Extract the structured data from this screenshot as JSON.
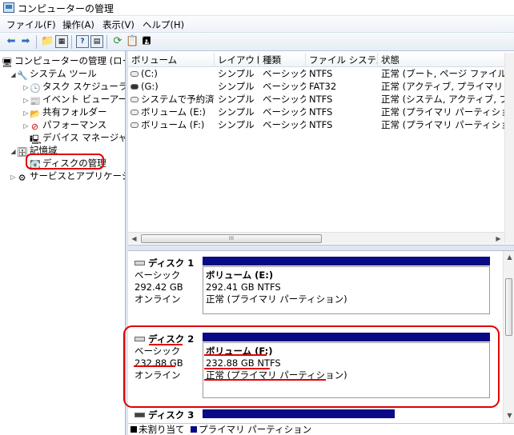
{
  "window": {
    "title": "コンピューターの管理"
  },
  "menu": [
    "ファイル(F)",
    "操作(A)",
    "表示(V)",
    "ヘルプ(H)"
  ],
  "tree": {
    "root": "コンピューターの管理 (ローカル)",
    "system_tools": "システム ツール",
    "task_scheduler": "タスク スケジューラ",
    "event_viewer": "イベント ビューアー",
    "shared_folders": "共有フォルダー",
    "performance": "パフォーマンス",
    "device_manager": "デバイス マネージャー",
    "storage": "記憶域",
    "disk_management": "ディスクの管理",
    "services_apps": "サービスとアプリケーション"
  },
  "list": {
    "headers": [
      "ボリューム",
      "レイアウト",
      "種類",
      "ファイル システム",
      "状態"
    ],
    "rows": [
      {
        "icon": "light",
        "volume": "(C:)",
        "layout": "シンプル",
        "type": "ベーシック",
        "fs": "NTFS",
        "status": "正常 (ブート, ページ ファイル, クラッシュ ダンプ, プライマリ パーティション)"
      },
      {
        "icon": "dark",
        "volume": "(G:)",
        "layout": "シンプル",
        "type": "ベーシック",
        "fs": "FAT32",
        "status": "正常 (アクティブ, プライマリ パーティション)"
      },
      {
        "icon": "light",
        "volume": "システムで予約済み",
        "layout": "シンプル",
        "type": "ベーシック",
        "fs": "NTFS",
        "status": "正常 (システム, アクティブ, プライマリ パーティション)"
      },
      {
        "icon": "light",
        "volume": "ボリューム (E:)",
        "layout": "シンプル",
        "type": "ベーシック",
        "fs": "NTFS",
        "status": "正常 (プライマリ パーティション)"
      },
      {
        "icon": "light",
        "volume": "ボリューム (F:)",
        "layout": "シンプル",
        "type": "ベーシック",
        "fs": "NTFS",
        "status": "正常 (プライマリ パーティション)"
      }
    ],
    "scroll_thumb": "III"
  },
  "disks": [
    {
      "name": "ディスク 1",
      "kind": "ベーシック",
      "size": "292.42 GB",
      "state": "オンライン",
      "part_name": "ボリューム (E:)",
      "part_size": "292.41 GB NTFS",
      "part_status": "正常 (プライマリ パーティション)"
    },
    {
      "name": "ディスク 2",
      "kind": "ベーシック",
      "size": "232.88 GB",
      "state": "オンライン",
      "part_name": "ボリューム (F:)",
      "part_size": "232.88 GB NTFS",
      "part_status": "正常 (プライマリ パーティション)"
    },
    {
      "name": "ディスク 3"
    }
  ],
  "legend": {
    "unallocated": "未割り当て",
    "primary": "プライマリ パーティション"
  },
  "colors": {
    "primary_partition": "#0a0a86",
    "unallocated": "#000000",
    "highlight": "#e00000"
  }
}
